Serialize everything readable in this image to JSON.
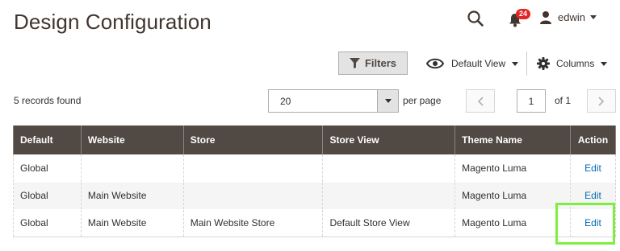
{
  "page": {
    "title": "Design Configuration"
  },
  "header": {
    "notifications_count": "24",
    "user_name": "edwin"
  },
  "toolbar": {
    "filters_label": "Filters",
    "view_label": "Default View",
    "columns_label": "Columns"
  },
  "grid": {
    "records_found": "5 records found",
    "per_page_value": "20",
    "per_page_label": "per page",
    "current_page": "1",
    "of_pages": "of 1",
    "columns": [
      "Default",
      "Website",
      "Store",
      "Store View",
      "Theme Name",
      "Action"
    ],
    "rows": [
      {
        "default": "Global",
        "website": "",
        "store": "",
        "store_view": "",
        "theme": "Magento Luma",
        "action": "Edit"
      },
      {
        "default": "Global",
        "website": "Main Website",
        "store": "",
        "store_view": "",
        "theme": "Magento Luma",
        "action": "Edit"
      },
      {
        "default": "Global",
        "website": "Main Website",
        "store": "Main Website Store",
        "store_view": "Default Store View",
        "theme": "Magento Luma",
        "action": "Edit"
      }
    ]
  },
  "icons": {
    "search": "search-icon",
    "bell": "bell-icon",
    "user": "user-icon",
    "filter": "filter-icon",
    "eye": "eye-icon",
    "gear": "gear-icon"
  },
  "colors": {
    "header_bg": "#514943",
    "link": "#006bb4",
    "badge": "#e22626",
    "highlight": "#7cf03e"
  }
}
